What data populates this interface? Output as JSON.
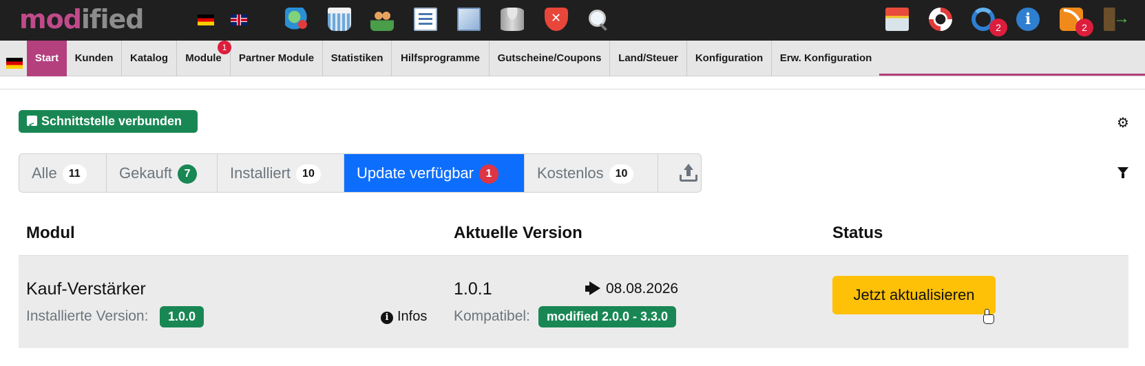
{
  "topbar": {
    "logo_part1": "mod",
    "logo_part2": "ified",
    "update_badge": "2",
    "rss_badge": "2"
  },
  "menu": {
    "items": [
      {
        "label": "Start"
      },
      {
        "label": "Kunden"
      },
      {
        "label": "Katalog"
      },
      {
        "label": "Module"
      },
      {
        "label": "Partner Module"
      },
      {
        "label": "Statistiken"
      },
      {
        "label": "Hilfsprogramme"
      },
      {
        "label": "Gutscheine/Coupons"
      },
      {
        "label": "Land/Steuer"
      },
      {
        "label": "Konfiguration"
      },
      {
        "label": "Erw. Konfiguration"
      }
    ],
    "module_badge": "1",
    "accent_color": "#b4407e"
  },
  "connection": {
    "label": "Schnittstelle verbunden",
    "color": "#198754"
  },
  "tabs": [
    {
      "label": "Alle",
      "count": "11"
    },
    {
      "label": "Gekauft",
      "count": "7"
    },
    {
      "label": "Installiert",
      "count": "10"
    },
    {
      "label": "Update verfügbar",
      "count": "1"
    },
    {
      "label": "Kostenlos",
      "count": "10"
    }
  ],
  "active_tab_color": "#0d6efd",
  "table": {
    "headers": {
      "modul": "Modul",
      "version": "Aktuelle Version",
      "status": "Status"
    },
    "row": {
      "name": "Kauf-Verstärker",
      "installed_label": "Installierte Version:",
      "installed_version": "1.0.0",
      "infos_label": "Infos",
      "current_version": "1.0.1",
      "release_date": "08.08.2026",
      "compat_label": "Kompatibel:",
      "compat_range": "modified 2.0.0 - 3.3.0",
      "action_label": "Jetzt aktualisieren",
      "action_color": "#ffc107"
    }
  },
  "icons": [
    "globe-icon",
    "basket-icon",
    "users-icon",
    "list-icon",
    "documents-icon",
    "database-icon",
    "shield-icon",
    "search-icon",
    "shop-icon",
    "help-icon",
    "refresh-icon",
    "info-icon",
    "rss-icon",
    "exit-icon",
    "gear-icon",
    "filter-icon",
    "upload-icon",
    "share-icon",
    "megaphone-icon"
  ]
}
